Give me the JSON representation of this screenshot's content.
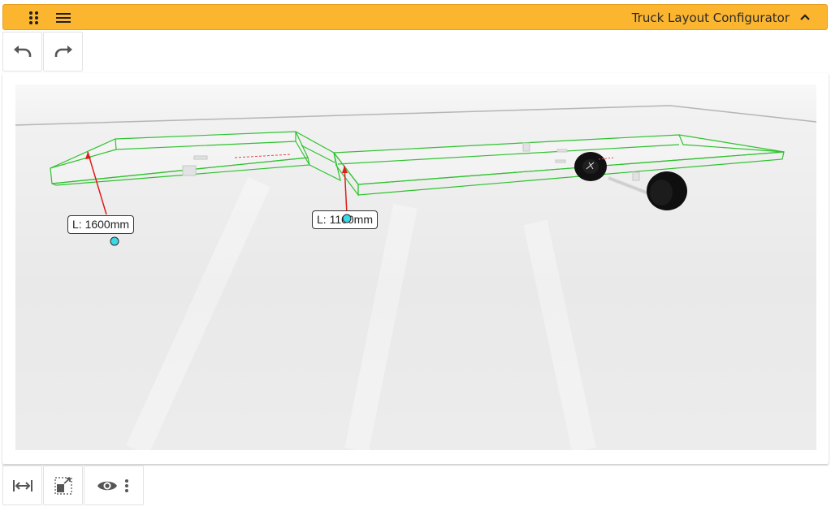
{
  "app": {
    "title": "Truck Layout Configurator",
    "accent_color": "#fbb52f"
  },
  "titlebar": {
    "drag_handle_icon": "drag-dots-icon",
    "menu_icon": "hamburger-menu-icon",
    "collapse_icon": "chevron-up-icon"
  },
  "toolbar_top": {
    "undo_icon": "undo-icon",
    "redo_icon": "redo-icon"
  },
  "viewer": {
    "outline_color": "#2fc22f",
    "dimension_color": "#e01b1b",
    "handle_color": "#3ad8e8",
    "dimensions": [
      {
        "label": "L: 1600mm"
      },
      {
        "label": "L: 1100mm"
      }
    ]
  },
  "toolbar_bottom": {
    "measure_icon": "measure-width-icon",
    "layout_icon": "resize-layout-icon",
    "visibility_icon": "eye-icon",
    "more_icon": "more-vertical-icon"
  }
}
